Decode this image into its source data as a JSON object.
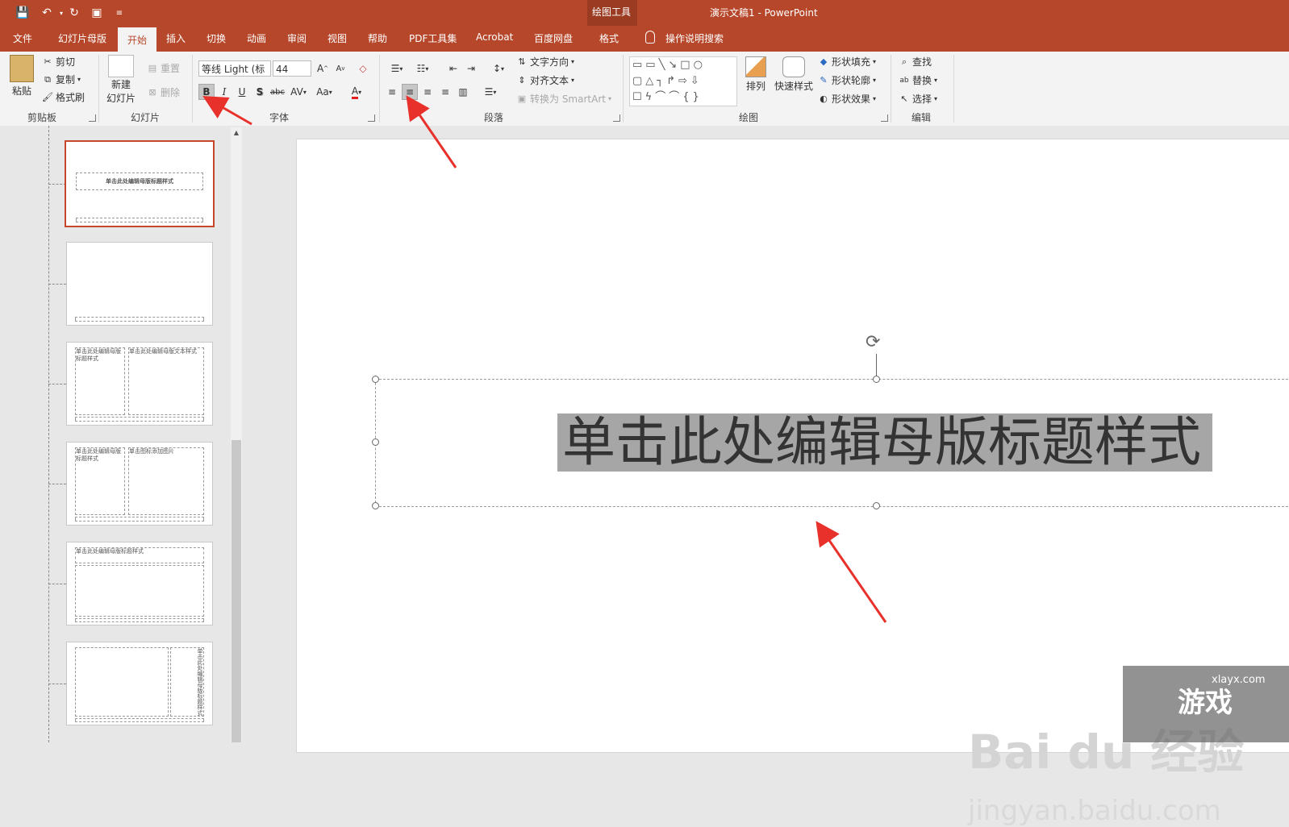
{
  "window": {
    "title": "演示文稿1  -  PowerPoint",
    "context_tab_group": "绘图工具"
  },
  "colors": {
    "accent": "#b7472a",
    "ribbon_bg": "#f3f3f3",
    "arrow": "#e8312a"
  },
  "tabs": [
    "文件",
    "幻灯片母版",
    "开始",
    "插入",
    "切换",
    "动画",
    "审阅",
    "视图",
    "帮助",
    "PDF工具集",
    "Acrobat",
    "百度网盘",
    "格式"
  ],
  "active_tab": "开始",
  "tell_me": "操作说明搜索",
  "ribbon": {
    "clipboard": {
      "paste": "粘贴",
      "cut": "剪切",
      "copy": "复制",
      "format_painter": "格式刷",
      "group": "剪贴板"
    },
    "slides": {
      "new_slide_1": "新建",
      "new_slide_2": "幻灯片",
      "reset": "重置",
      "delete": "删除",
      "group": "幻灯片"
    },
    "font": {
      "name": "等线 Light (标",
      "size": "44",
      "bold": "B",
      "italic": "I",
      "underline": "U",
      "shadow": "S",
      "strike": "abc",
      "spacing": "AV",
      "case": "Aa",
      "color": "A",
      "group": "字体"
    },
    "paragraph": {
      "text_direction": "文字方向",
      "align_text": "对齐文本",
      "smartart": "转换为 SmartArt",
      "group": "段落"
    },
    "drawing": {
      "arrange": "排列",
      "quick_styles": "快速样式",
      "shape_fill": "形状填充",
      "shape_outline": "形状轮廓",
      "shape_effects": "形状效果",
      "group": "绘图"
    },
    "editing": {
      "find": "查找",
      "replace": "替换",
      "select": "选择",
      "group": "编辑"
    }
  },
  "thumbnails": [
    {
      "title": "单击此处编辑母版标题样式"
    },
    {
      "title": ""
    },
    {
      "left": "单击此处编辑母版标题样式",
      "right": "单击此处编辑母版文本样式"
    },
    {
      "left": "单击此处编辑母版标题样式",
      "right": "单击图标添加图片"
    },
    {
      "title": "单击此处编辑母版标题样式"
    },
    {
      "right": "单击此处编辑母版标题样式"
    }
  ],
  "slide": {
    "title_placeholder": "单击此处编辑母版标题样式"
  },
  "watermark": {
    "text": "Bai du 经验",
    "sub": "jingyan.baidu.com",
    "badge": "游戏",
    "badge_url": "xlayx.com"
  }
}
